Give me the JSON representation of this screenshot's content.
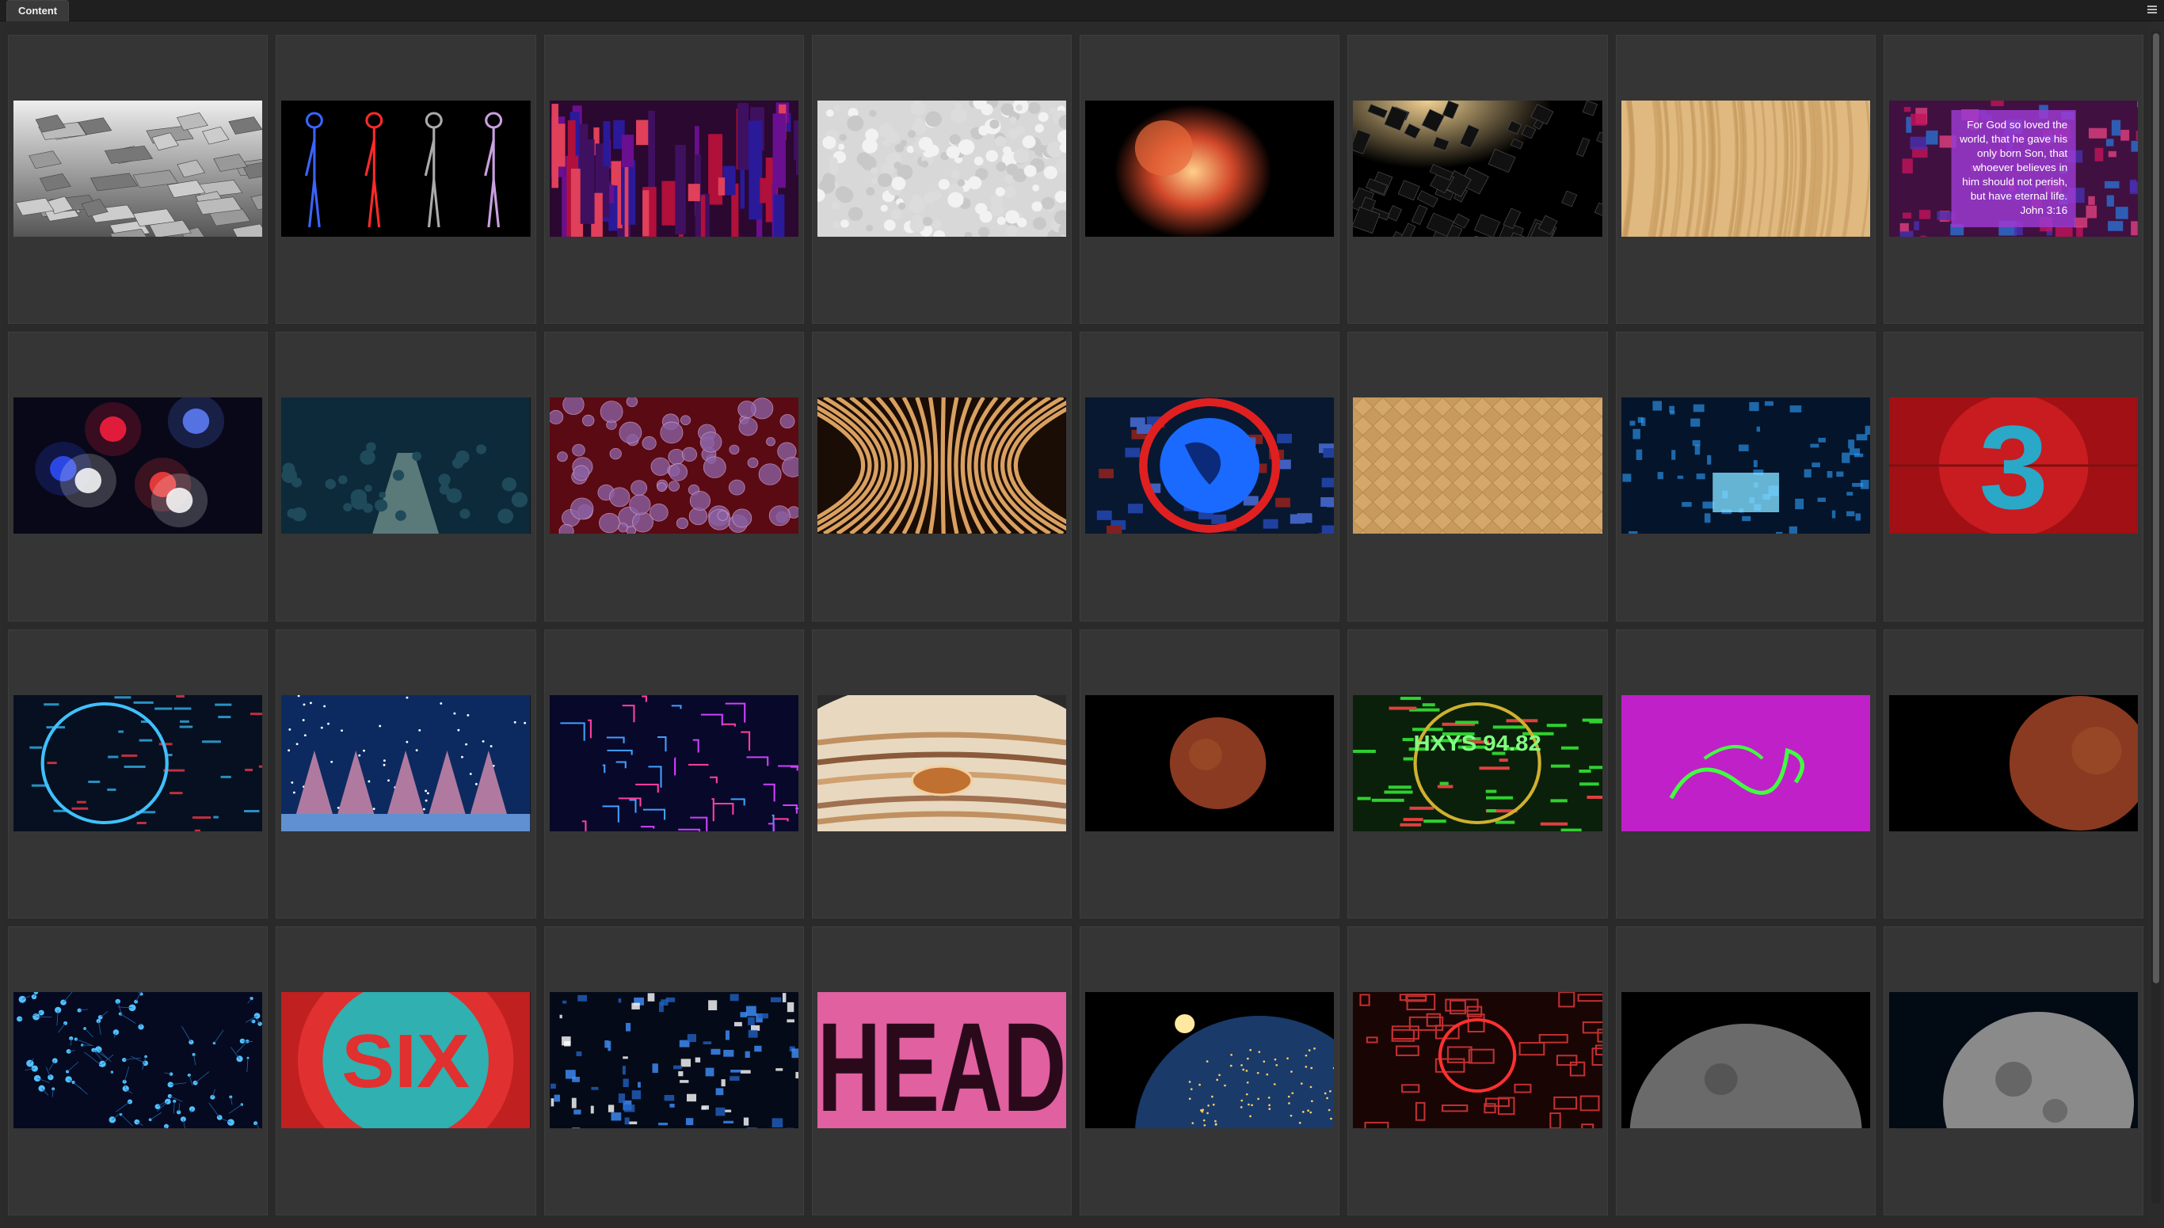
{
  "panel": {
    "tab_label": "Content",
    "menu_icon": "hamburger-icon"
  },
  "thumbnails": [
    {
      "id": 1,
      "kind": "silver-cubes",
      "caption_lines": []
    },
    {
      "id": 2,
      "kind": "human-bodies"
    },
    {
      "id": 3,
      "kind": "red-purple-bars"
    },
    {
      "id": 4,
      "kind": "white-bumps"
    },
    {
      "id": 5,
      "kind": "fetus"
    },
    {
      "id": 6,
      "kind": "dark-cubes"
    },
    {
      "id": 7,
      "kind": "tan-wood"
    },
    {
      "id": 8,
      "kind": "john-316",
      "verse": [
        "For God so loved the",
        "world, that he gave his",
        "only born Son, that",
        "whoever believes in",
        "him should not perish,",
        "but have eternal life.",
        "John 3:16"
      ]
    },
    {
      "id": 9,
      "kind": "police-lights"
    },
    {
      "id": 10,
      "kind": "teal-corridor"
    },
    {
      "id": 11,
      "kind": "red-bubbles"
    },
    {
      "id": 12,
      "kind": "gold-tunnel"
    },
    {
      "id": 13,
      "kind": "blue-globe"
    },
    {
      "id": 14,
      "kind": "tan-pattern"
    },
    {
      "id": 15,
      "kind": "blue-cube"
    },
    {
      "id": 16,
      "kind": "red-three",
      "text": "3"
    },
    {
      "id": 17,
      "kind": "hud-circle"
    },
    {
      "id": 18,
      "kind": "snow-trees"
    },
    {
      "id": 19,
      "kind": "neon-circuit"
    },
    {
      "id": 20,
      "kind": "jupiter"
    },
    {
      "id": 21,
      "kind": "mars-dark"
    },
    {
      "id": 22,
      "kind": "green-ticker",
      "text": "HXYS 94.82"
    },
    {
      "id": 23,
      "kind": "magenta-scribble"
    },
    {
      "id": 24,
      "kind": "mars-right"
    },
    {
      "id": 25,
      "kind": "blue-network"
    },
    {
      "id": 26,
      "kind": "six-circle",
      "text": "SIX"
    },
    {
      "id": 27,
      "kind": "blue-data"
    },
    {
      "id": 28,
      "kind": "pink-head",
      "text": "HEAD"
    },
    {
      "id": 29,
      "kind": "earth-night"
    },
    {
      "id": 30,
      "kind": "red-dashboard"
    },
    {
      "id": 31,
      "kind": "moon-dim"
    },
    {
      "id": 32,
      "kind": "moon-full"
    }
  ],
  "colors": {
    "panel_bg": "#2b2b2b",
    "cell_bg": "#353535",
    "accent": "#5a8dd8"
  }
}
